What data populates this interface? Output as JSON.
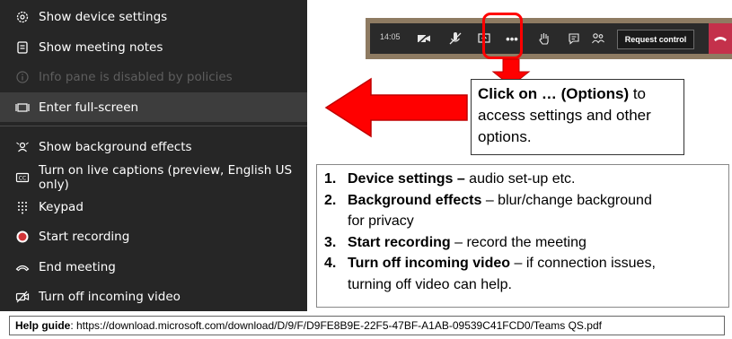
{
  "menu": {
    "items": [
      {
        "label": "Show device settings",
        "icon": "gear-icon"
      },
      {
        "label": "Show meeting notes",
        "icon": "notes-icon"
      },
      {
        "label": "Info pane is disabled by policies",
        "icon": "info-icon"
      },
      {
        "label": "Enter full-screen",
        "icon": "fullscreen-icon"
      },
      {
        "label": "Show background effects",
        "icon": "background-effects-icon"
      },
      {
        "label": "Turn on live captions (preview, English US only)",
        "icon": "captions-icon"
      },
      {
        "label": "Keypad",
        "icon": "keypad-icon"
      },
      {
        "label": "Start recording",
        "icon": "record-icon"
      },
      {
        "label": "End meeting",
        "icon": "end-meeting-icon"
      },
      {
        "label": "Turn off incoming video",
        "icon": "video-off-icon"
      }
    ]
  },
  "toolbar": {
    "time": "14:05",
    "more_label": "•••",
    "request_control": "Request control"
  },
  "callout": {
    "bold": "Click on … (Options)",
    "rest": " to access settings and other options."
  },
  "steps": [
    {
      "num": "1.",
      "bold": "Device settings –",
      "text": " audio set-up etc.",
      "cont": ""
    },
    {
      "num": "2.",
      "bold": "Background effects",
      "text": " – blur/change background",
      "cont": "for privacy"
    },
    {
      "num": "3.",
      "bold": "Start recording",
      "text": " – record the meeting",
      "cont": ""
    },
    {
      "num": "4.",
      "bold": "Turn off incoming video",
      "text": " – if connection issues,",
      "cont": "turning off video can help."
    }
  ],
  "help": {
    "label": "Help guide",
    "url": ": https://download.microsoft.com/download/D/9/F/D9FE8B9E-22F5-47BF-A1AB-09539C41FCD0/Teams QS.pdf"
  },
  "colors": {
    "menu_bg": "#262626",
    "accent_red": "#ff0000",
    "hangup": "#c4314b"
  }
}
